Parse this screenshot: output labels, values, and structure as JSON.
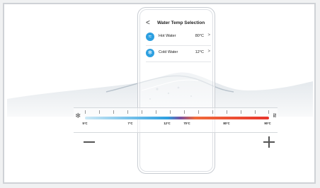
{
  "screen": {
    "back": "<",
    "title": "Water Temp Selection",
    "hot": {
      "label": "Hot Water",
      "value": "80°C",
      "chevron": ">"
    },
    "cold": {
      "label": "Cold Water",
      "value": "12°C",
      "chevron": ">"
    }
  },
  "slider": {
    "labels": [
      "5°C",
      "7°C",
      "12°C",
      "70°C",
      "80°C",
      "90°C"
    ],
    "minus": "—",
    "plus": "+"
  },
  "colors": {
    "accent_blue": "#2c9fe0",
    "hot_red": "#e8342b"
  }
}
